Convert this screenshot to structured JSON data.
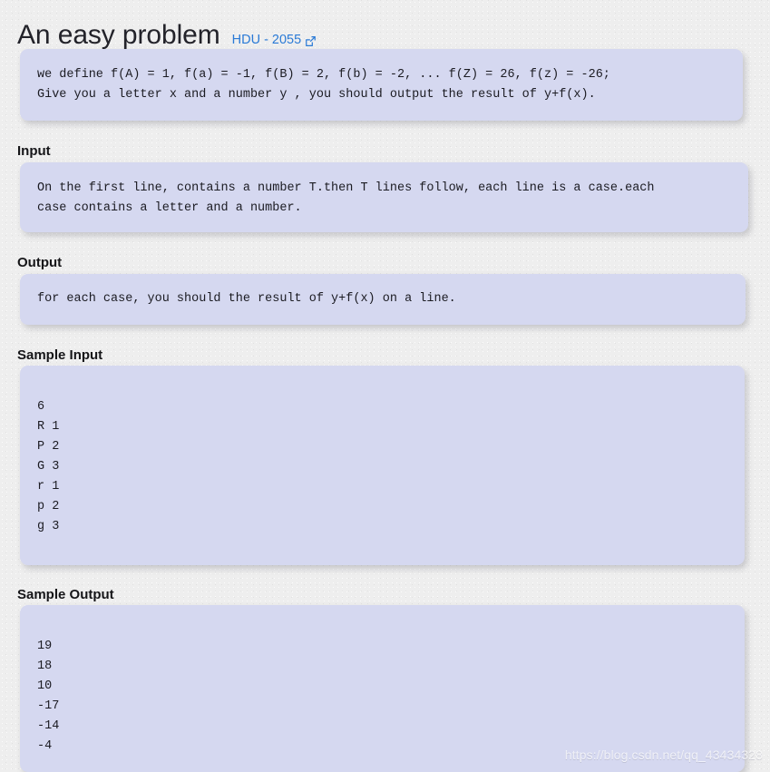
{
  "page": {
    "title": "An easy problem",
    "source_link": {
      "label": "HDU - 2055",
      "icon": "external-link-icon",
      "color": "#2a7ad6"
    },
    "watermark": "https://blog.csdn.net/qq_43434328"
  },
  "theme": {
    "page_background": "#eeeeee",
    "panel_background": "#d5d8f0",
    "heading_color": "#151518",
    "title_color": "#23232a",
    "link_color": "#2a7ad6"
  },
  "description": {
    "text": "we define f(A) = 1, f(a) = -1, f(B) = 2, f(b) = -2, ... f(Z) = 26, f(z) = -26;\nGive you a letter x and a number y , you should output the result of y+f(x)."
  },
  "sections": [
    {
      "heading": "Input",
      "text": "On the first line, contains a number T.then T lines follow, each line is a case.each\ncase contains a letter and a number."
    },
    {
      "heading": "Output",
      "text": "for each case, you should the result of y+f(x) on a line."
    },
    {
      "heading": "Sample Input",
      "text": "6\nR 1\nP 2\nG 3\nr 1\np 2\ng 3"
    },
    {
      "heading": "Sample Output",
      "text": "19\n18\n10\n-17\n-14\n-4"
    }
  ]
}
